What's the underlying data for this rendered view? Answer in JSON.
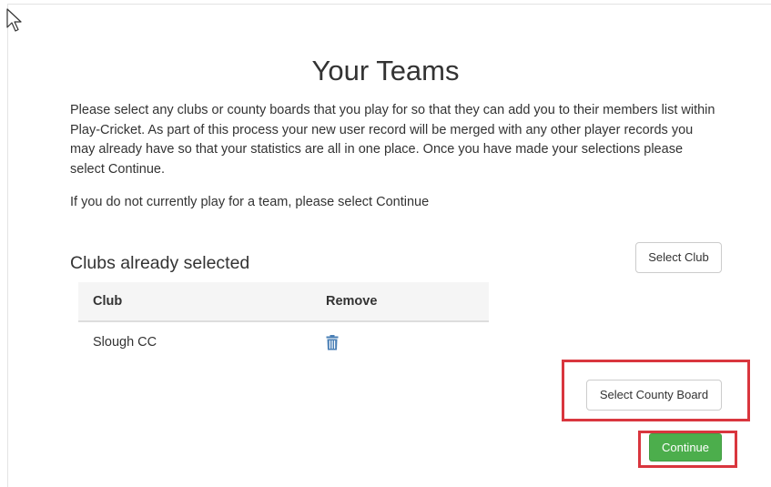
{
  "page": {
    "title": "Your Teams",
    "intro": "Please select any clubs or county boards that you play for so that they can add you to their members list within Play-Cricket. As part of this process your new user record will be merged with any other player records you may already have so that your statistics are all in one place. Once you have made your selections please select Continue.",
    "no_team_note": "If you do not currently play for a team, please select Continue"
  },
  "clubs": {
    "section_title": "Clubs already selected",
    "select_club_label": "Select Club",
    "columns": [
      "Club",
      "Remove"
    ],
    "rows": [
      {
        "club": "Slough CC",
        "remove_icon": "trash-icon"
      }
    ]
  },
  "actions": {
    "select_county_board_label": "Select County Board",
    "continue_label": "Continue"
  },
  "colors": {
    "continue_green": "#4cae4c",
    "highlight_red": "#d9363e",
    "trash_blue": "#4a7fb5"
  }
}
